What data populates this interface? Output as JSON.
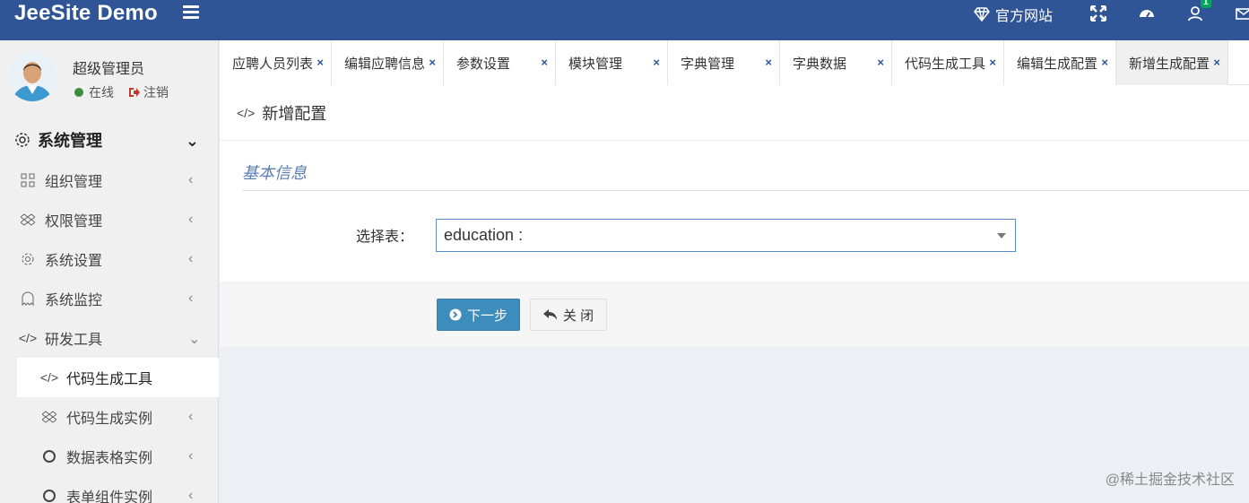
{
  "app": {
    "brand": "JeeSite Demo"
  },
  "header": {
    "site_label": "官方网站",
    "notification_count": "1"
  },
  "user": {
    "name": "超级管理员",
    "status": "在线",
    "logout": "注销"
  },
  "menu": {
    "header": "系统管理",
    "items": [
      {
        "label": "组织管理",
        "icon": "grid-icon"
      },
      {
        "label": "权限管理",
        "icon": "dropbox-icon"
      },
      {
        "label": "系统设置",
        "icon": "gear-icon"
      },
      {
        "label": "系统监控",
        "icon": "ghost-icon"
      },
      {
        "label": "研发工具",
        "icon": "code-icon"
      }
    ],
    "sub_items": [
      {
        "label": "代码生成工具",
        "icon": "code-icon"
      },
      {
        "label": "代码生成实例",
        "icon": "dropbox-icon"
      },
      {
        "label": "数据表格实例",
        "icon": "circle-icon"
      },
      {
        "label": "表单组件实例",
        "icon": "circle-icon"
      }
    ]
  },
  "tabs": [
    {
      "label": "应聘人员列表"
    },
    {
      "label": "编辑应聘信息"
    },
    {
      "label": "参数设置"
    },
    {
      "label": "模块管理"
    },
    {
      "label": "字典管理"
    },
    {
      "label": "字典数据"
    },
    {
      "label": "代码生成工具"
    },
    {
      "label": "编辑生成配置"
    },
    {
      "label": "新增生成配置"
    }
  ],
  "tab_close": "×",
  "page": {
    "title": "新增配置",
    "section": "基本信息",
    "field_label": "选择表：",
    "select_value": "education :",
    "next_button": "下一步",
    "close_button": "关 闭"
  },
  "watermark": "@稀土掘金技术社区",
  "colors": {
    "header_bg": "#2f5597",
    "primary": "#3c8dbc",
    "section_text": "#5b7fb5"
  }
}
